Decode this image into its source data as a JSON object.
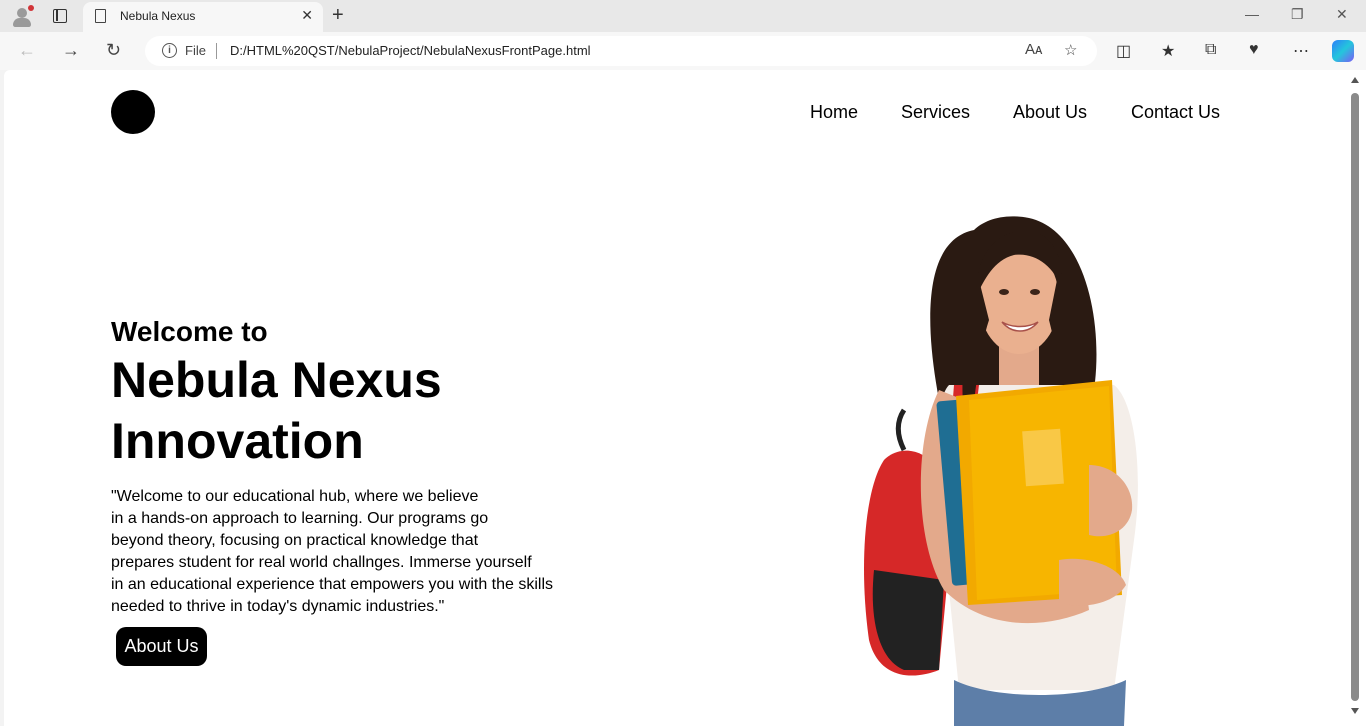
{
  "browser": {
    "tab_title": "Nebula Nexus",
    "close_glyph": "✕",
    "new_tab_glyph": "+",
    "address_prefix": "File",
    "url": "D:/HTML%20QST/NebulaProject/NebulaNexusFrontPage.html",
    "icons": [
      "profile-icon",
      "tab-actions-icon",
      "page-icon",
      "close-icon",
      "new-tab-icon",
      "back-icon",
      "forward-icon",
      "refresh-icon",
      "info-icon",
      "read-aloud-icon",
      "favorite-icon",
      "split-screen-icon",
      "favorites-icon",
      "collections-icon",
      "performance-icon",
      "more-icon",
      "copilot-icon",
      "minimize-icon",
      "restore-icon",
      "window-close-icon"
    ]
  },
  "site": {
    "nav": [
      "Home",
      "Services",
      "About Us",
      "Contact Us"
    ],
    "welcome": "Welcome to",
    "brand_line1": "Nebula Nexus",
    "brand_line2": "Innovation",
    "paragraph": [
      "\"Welcome to our educational hub, where we believe",
      "in a hands-on approach to learning. Our programs go",
      "beyond theory, focusing on practical knowledge that",
      "prepares student for real world challnges. Immerse yourself",
      "in an educational experience that empowers you with the skills",
      "needed to thrive in today's dynamic industries.\""
    ],
    "cta": "About Us"
  },
  "colors": {
    "accent": "#000000",
    "background": "#ffffff",
    "chrome": "#f3f3f3"
  }
}
